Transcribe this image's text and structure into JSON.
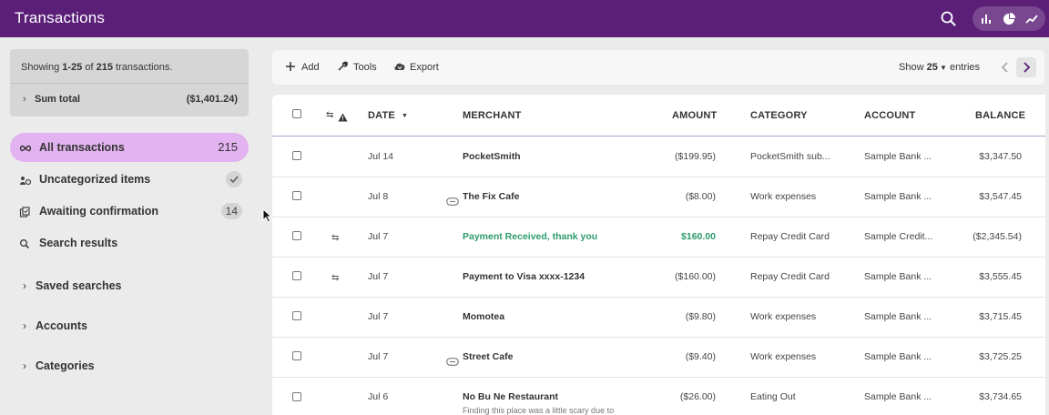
{
  "header": {
    "title": "Transactions"
  },
  "summary": {
    "showing_prefix": "Showing ",
    "range": "1-25",
    "of_text": " of ",
    "total": "215",
    "suffix": " transactions.",
    "sum_label": "Sum total",
    "sum_value": "($1,401.24)"
  },
  "nav": {
    "all": {
      "label": "All transactions",
      "count": "215"
    },
    "uncategorized": {
      "label": "Uncategorized items"
    },
    "awaiting": {
      "label": "Awaiting confirmation",
      "count": "14"
    },
    "search": {
      "label": "Search results"
    }
  },
  "sections": {
    "saved_searches": "Saved searches",
    "accounts": "Accounts",
    "categories": "Categories"
  },
  "toolbar": {
    "add": "Add",
    "tools": "Tools",
    "export": "Export",
    "show_prefix": "Show ",
    "show_count": "25",
    "show_suffix": " entries"
  },
  "columns": {
    "date": "DATE",
    "merchant": "MERCHANT",
    "amount": "AMOUNT",
    "category": "CATEGORY",
    "account": "ACCOUNT",
    "balance": "BALANCE"
  },
  "rows": [
    {
      "date": "Jul 14",
      "merchant": "PocketSmith",
      "amount": "($199.95)",
      "category": "PocketSmith sub...",
      "account": "Sample Bank ...",
      "balance": "$3,347.50"
    },
    {
      "date": "Jul 8",
      "merchant": "The Fix Cafe",
      "amount": "($8.00)",
      "category": "Work expenses",
      "account": "Sample Bank ...",
      "balance": "$3,547.45"
    },
    {
      "date": "Jul 7",
      "merchant": "Payment Received, thank you",
      "amount": "$160.00",
      "category": "Repay Credit Card",
      "account": "Sample Credit...",
      "balance": "($2,345.54)"
    },
    {
      "date": "Jul 7",
      "merchant": "Payment to Visa xxxx-1234",
      "amount": "($160.00)",
      "category": "Repay Credit Card",
      "account": "Sample Bank ...",
      "balance": "$3,555.45"
    },
    {
      "date": "Jul 7",
      "merchant": "Momotea",
      "amount": "($9.80)",
      "category": "Work expenses",
      "account": "Sample Bank ...",
      "balance": "$3,715.45"
    },
    {
      "date": "Jul 7",
      "merchant": "Street Cafe",
      "amount": "($9.40)",
      "category": "Work expenses",
      "account": "Sample Bank ...",
      "balance": "$3,725.25"
    },
    {
      "date": "Jul 6",
      "merchant": "No Bu Ne Restaurant",
      "note": "Finding this place was a little scary due to",
      "amount": "($26.00)",
      "category": "Eating Out",
      "account": "Sample Bank ...",
      "balance": "$3,734.65"
    }
  ],
  "icons": {
    "search": "search-icon",
    "bar_chart": "bar-chart-icon",
    "pie_chart": "pie-chart-icon",
    "trend": "line-chart-icon",
    "transfer": "transfer-icon",
    "warning": "warning-icon",
    "tag": "tag-icon"
  },
  "colors": {
    "header": "#5b1f78",
    "active_nav": "#e2b3f0",
    "credit": "#2e9a6e"
  }
}
